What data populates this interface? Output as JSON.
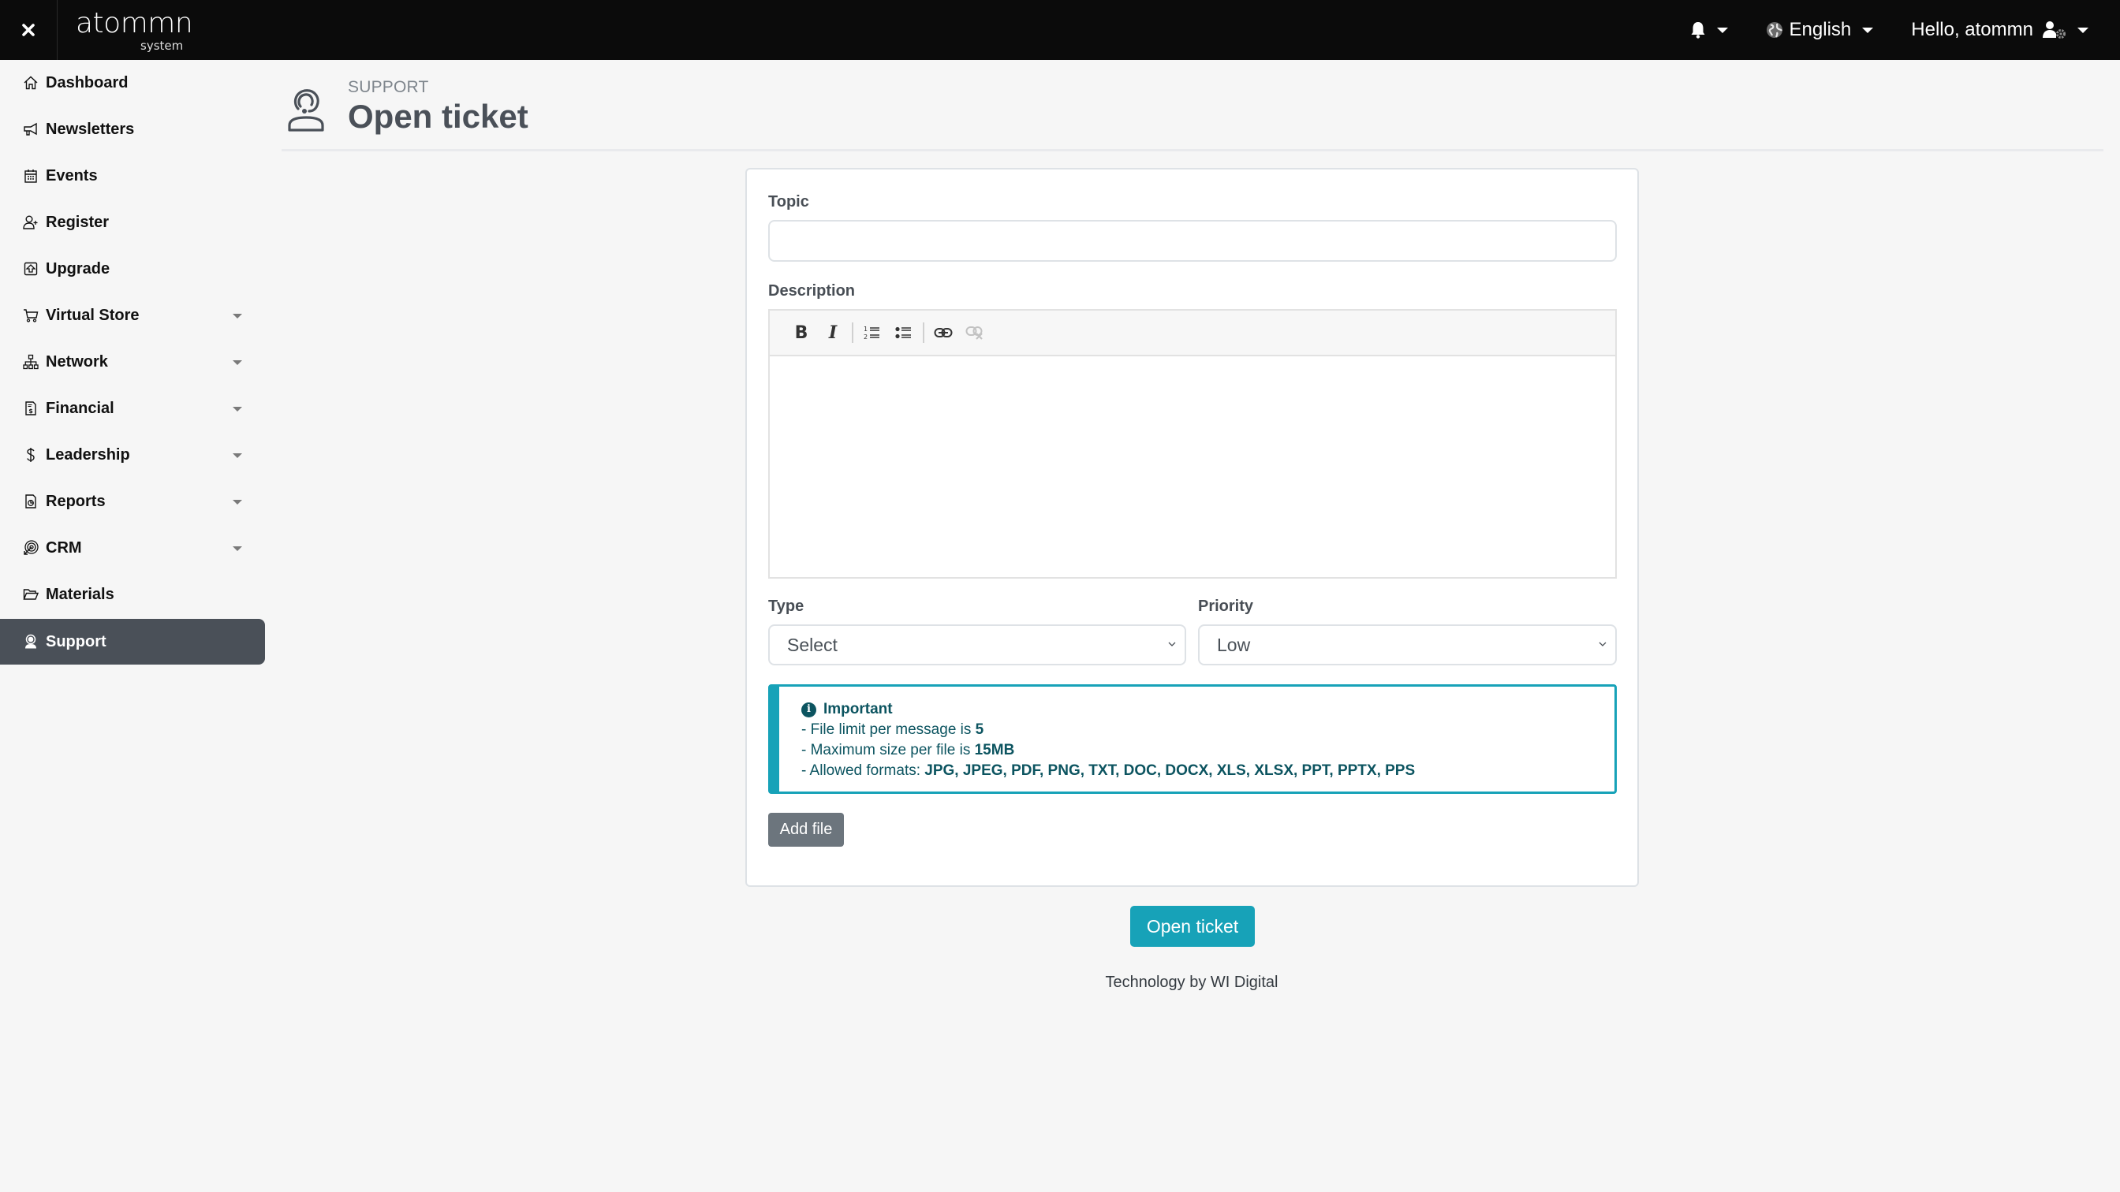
{
  "header": {
    "close_label": "×",
    "logo": {
      "brand": "atommn",
      "sub": "system"
    },
    "notifications_icon": "bell-icon",
    "language": {
      "icon": "globe-icon",
      "label": "English"
    },
    "user": {
      "greeting": "Hello, atommn",
      "icon": "user-gear-icon"
    }
  },
  "sidebar": {
    "items": [
      {
        "label": "Dashboard",
        "icon": "home-icon",
        "has_submenu": false,
        "active": false
      },
      {
        "label": "Newsletters",
        "icon": "megaphone-icon",
        "has_submenu": false,
        "active": false
      },
      {
        "label": "Events",
        "icon": "calendar-icon",
        "has_submenu": false,
        "active": false
      },
      {
        "label": "Register",
        "icon": "user-plus-icon",
        "has_submenu": false,
        "active": false
      },
      {
        "label": "Upgrade",
        "icon": "upgrade-icon",
        "has_submenu": false,
        "active": false
      },
      {
        "label": "Virtual Store",
        "icon": "cart-icon",
        "has_submenu": true,
        "active": false
      },
      {
        "label": "Network",
        "icon": "network-icon",
        "has_submenu": true,
        "active": false
      },
      {
        "label": "Financial",
        "icon": "invoice-icon",
        "has_submenu": true,
        "active": false
      },
      {
        "label": "Leadership",
        "icon": "dollar-icon",
        "has_submenu": true,
        "active": false
      },
      {
        "label": "Reports",
        "icon": "report-icon",
        "has_submenu": true,
        "active": false
      },
      {
        "label": "CRM",
        "icon": "target-icon",
        "has_submenu": true,
        "active": false
      },
      {
        "label": "Materials",
        "icon": "folder-icon",
        "has_submenu": false,
        "active": false
      },
      {
        "label": "Support",
        "icon": "support-icon",
        "has_submenu": false,
        "active": true
      }
    ]
  },
  "page": {
    "section": "SUPPORT",
    "title": "Open ticket",
    "icon": "support-agent-icon"
  },
  "form": {
    "topic": {
      "label": "Topic",
      "value": "",
      "placeholder": ""
    },
    "description": {
      "label": "Description",
      "value": "",
      "toolbar": [
        "bold",
        "italic",
        "ordered-list",
        "unordered-list",
        "link",
        "unlink"
      ],
      "toolbar_glyphs": {
        "bold": "B",
        "italic": "I"
      }
    },
    "type": {
      "label": "Type",
      "selected": "Select"
    },
    "priority": {
      "label": "Priority",
      "selected": "Low"
    },
    "notice": {
      "title": "Important",
      "lines": [
        {
          "text": "- File limit per message is ",
          "strong": "5"
        },
        {
          "text": "- Maximum size per file is ",
          "strong": "15MB"
        },
        {
          "text": "- Allowed formats: ",
          "strong": "JPG, JPEG, PDF, PNG, TXT, DOC, DOCX, XLS, XLSX, PPT, PPTX, PPS"
        }
      ]
    },
    "add_file_label": "Add file",
    "submit_label": "Open ticket"
  },
  "footer": {
    "text": "Technology by WI Digital"
  },
  "colors": {
    "header_bg": "#0b0b0b",
    "page_bg": "#f6f6f6",
    "sidebar_active": "#4a5058",
    "accent": "#17a2b8",
    "secondary_button": "#6c757d",
    "alert_text": "#0c5460"
  }
}
